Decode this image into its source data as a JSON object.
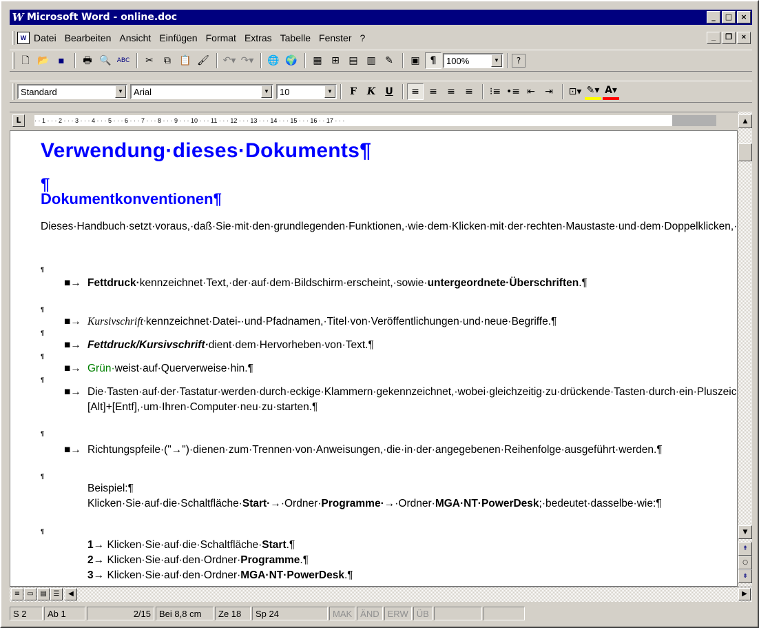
{
  "window": {
    "title": "Microsoft Word - online.doc",
    "logo": "W"
  },
  "menu": [
    "Datei",
    "Bearbeiten",
    "Ansicht",
    "Einfügen",
    "Format",
    "Extras",
    "Tabelle",
    "Fenster",
    "?"
  ],
  "formatting": {
    "style": "Standard",
    "font": "Arial",
    "size": "10",
    "zoom": "100%",
    "bold_label": "F",
    "italic_label": "K",
    "underline_label": "U"
  },
  "ruler": {
    "marks": "· · 1 · · · 2 · · · 3 · · · 4 · · · 5 · · · 6 · · · 7 · · · 8 · · · 9 · · · 10 · · · 11 · · · 12 · · · 13 · · · 14 · · · 15 · · · 16 · · 17 · · ·"
  },
  "document": {
    "heading1": "Verwendung·dieses·Dokuments¶",
    "empty_para": "¶",
    "heading2": "Dokumentkonventionen¶",
    "intro": "Dieses·Handbuch·setzt·voraus,·daß·Sie·mit·den·grundlegenden·Funktionen,·wie·dem·Klicken·mit·der·rechten·Maustaste·und·dem·Doppelklicken,·sowie·mit·Windows·NT·vertraut·sind.·Darüber·hinaus·gelten·die·folgenden·Konventionen:¶",
    "pilcrow": "¶",
    "bullet": "■→",
    "bullets": {
      "b1_bold": "Fettdruck·",
      "b1_text": "kennzeichnet·Text,·der·auf·dem·Bildschirm·erscheint,·sowie·",
      "b1_bold2": "untergeordnete·Überschriften",
      "b1_end": ".¶",
      "b2_ital": "Kursivschrift·",
      "b2_text": "kennzeichnet·Datei-·und·Pfadnamen,·Titel·von·Veröffentlichungen·und·neue·Begriffe.¶",
      "b3_bi": "Fettdruck/Kursivschrift·",
      "b3_text": "dient·dem·Hervorheben·von·Text.¶",
      "b4_green": "Grün·",
      "b4_text": "weist·auf·Querverweise·hin.¶",
      "b5_text": "Die·Tasten·auf·der·Tastatur·werden·durch·eckige·Klammern·gekennzeichnet,·wobei·gleichzeitig·zu·drückende·Tasten·durch·ein·Pluszeichen·verbunden·werden.·Beispiel:·Drücken·Sie·[Strg]+[Alt]+[Entf],·um·Ihren·Computer·neu·zu·starten.¶",
      "b6_text": "Richtungspfeile·(\"→\")·dienen·zum·Trennen·von·Anweisungen,·die·in·der·angegebenen·Reihenfolge·ausgeführt·werden.¶"
    },
    "example": {
      "label": "Beispiel:¶",
      "l1": "Klicken·Sie·auf·die·Schaltfläche·",
      "start": "Start·",
      "l2": "→·Ordner·",
      "programme": "Programme·",
      "l3": "→·Ordner·",
      "mga": "MGA·NT·PowerDesk",
      "l4": ";·bedeutet·dasselbe·wie:¶"
    },
    "steps": [
      {
        "num": "1→",
        "text": "Klicken·Sie·auf·die·Schaltfläche·",
        "bold": "Start",
        "end": ".¶"
      },
      {
        "num": "2→",
        "text": "Klicken·Sie·auf·den·Ordner·",
        "bold": "Programme",
        "end": ".¶"
      },
      {
        "num": "3→",
        "text": "Klicken·Sie·auf·den·Ordner·",
        "bold": "MGA·NT·PowerDesk",
        "end": ".¶"
      }
    ]
  },
  "status": {
    "page": "S 2",
    "section": "Ab 1",
    "count": "2/15",
    "pos": "Bei 8,8 cm",
    "line": "Ze 18",
    "col": "Sp 24",
    "mak": "MAK",
    "aend": "ÄND",
    "erw": "ERW",
    "ueb": "ÜB"
  }
}
